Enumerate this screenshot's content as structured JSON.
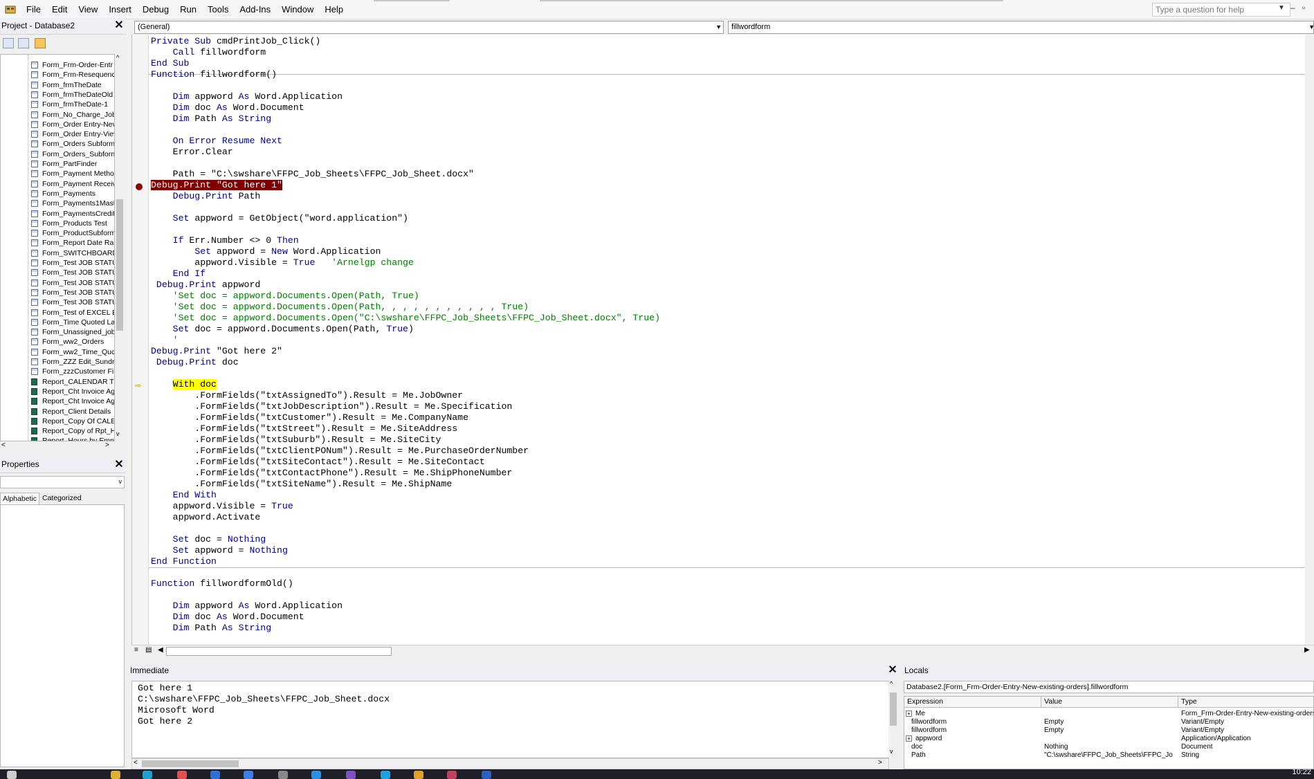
{
  "menu": [
    "File",
    "Edit",
    "View",
    "Insert",
    "Debug",
    "Run",
    "Tools",
    "Add-Ins",
    "Window",
    "Help"
  ],
  "help_placeholder": "Type a question for help",
  "project": {
    "title": "Project - Database2",
    "items": [
      {
        "label": "Form_Frm-Order-Entr",
        "type": "form"
      },
      {
        "label": "Form_Frm-Resequenc",
        "type": "form"
      },
      {
        "label": "Form_frmTheDate",
        "type": "form"
      },
      {
        "label": "Form_frmTheDateOld",
        "type": "form"
      },
      {
        "label": "Form_frmTheDate-1",
        "type": "form"
      },
      {
        "label": "Form_No_Charge_Job",
        "type": "form"
      },
      {
        "label": "Form_Order Entry-Nev",
        "type": "form"
      },
      {
        "label": "Form_Order Entry-Viev",
        "type": "form"
      },
      {
        "label": "Form_Orders Subform",
        "type": "form"
      },
      {
        "label": "Form_Orders_Subforn",
        "type": "form"
      },
      {
        "label": "Form_PartFinder",
        "type": "form"
      },
      {
        "label": "Form_Payment Methoc",
        "type": "form"
      },
      {
        "label": "Form_Payment Receiv",
        "type": "form"
      },
      {
        "label": "Form_Payments",
        "type": "form"
      },
      {
        "label": "Form_Payments1Mast",
        "type": "form"
      },
      {
        "label": "Form_PaymentsCredit",
        "type": "form"
      },
      {
        "label": "Form_Products Test",
        "type": "form"
      },
      {
        "label": "Form_ProductSubform",
        "type": "form"
      },
      {
        "label": "Form_Report Date Rar",
        "type": "form"
      },
      {
        "label": "Form_SWITCHBOARD",
        "type": "form"
      },
      {
        "label": "Form_Test JOB STATU",
        "type": "form"
      },
      {
        "label": "Form_Test JOB STATU",
        "type": "form"
      },
      {
        "label": "Form_Test JOB STATU",
        "type": "form"
      },
      {
        "label": "Form_Test JOB STATU",
        "type": "form"
      },
      {
        "label": "Form_Test JOB STATU",
        "type": "form"
      },
      {
        "label": "Form_Test of EXCEL E",
        "type": "form"
      },
      {
        "label": "Form_Time Quoted La",
        "type": "form"
      },
      {
        "label": "Form_Unassigned_job",
        "type": "form"
      },
      {
        "label": "Form_ww2_Orders",
        "type": "form"
      },
      {
        "label": "Form_ww2_Time_Quc",
        "type": "form"
      },
      {
        "label": "Form_ZZZ  Edit_Sundr",
        "type": "form"
      },
      {
        "label": "Form_zzzCustomer Fir",
        "type": "form"
      },
      {
        "label": "Report_CALENDAR TES",
        "type": "report"
      },
      {
        "label": "Report_Cht Invoice Ag",
        "type": "report"
      },
      {
        "label": "Report_Cht Invoice Ag",
        "type": "report"
      },
      {
        "label": "Report_Client Details",
        "type": "report"
      },
      {
        "label": "Report_Copy Of CALEN",
        "type": "report"
      },
      {
        "label": "Report_Copy of Rpt_H",
        "type": "report"
      },
      {
        "label": "Report_Hours by Empl",
        "type": "report"
      }
    ]
  },
  "properties": {
    "title": "Properties",
    "tabs": [
      "Alphabetic",
      "Categorized"
    ]
  },
  "code": {
    "object_combo": "(General)",
    "proc_combo": "fillwordform",
    "lines": [
      [
        [
          "k",
          "Private Sub "
        ],
        [
          "n",
          "cmdPrintJob_Click()"
        ]
      ],
      [
        [
          "n",
          "    "
        ],
        [
          "k",
          "Call"
        ],
        [
          "n",
          " fillwordform"
        ]
      ],
      [
        [
          "k",
          "End Sub"
        ]
      ],
      [
        [
          "k",
          "Function"
        ],
        [
          "n",
          " fillwordform()"
        ]
      ],
      [],
      [
        [
          "n",
          "    "
        ],
        [
          "k",
          "Dim"
        ],
        [
          "n",
          " appword "
        ],
        [
          "k",
          "As"
        ],
        [
          "n",
          " Word.Application"
        ]
      ],
      [
        [
          "n",
          "    "
        ],
        [
          "k",
          "Dim"
        ],
        [
          "n",
          " doc "
        ],
        [
          "k",
          "As"
        ],
        [
          "n",
          " Word.Document"
        ]
      ],
      [
        [
          "n",
          "    "
        ],
        [
          "k",
          "Dim"
        ],
        [
          "n",
          " Path "
        ],
        [
          "k",
          "As String"
        ]
      ],
      [],
      [
        [
          "n",
          "    "
        ],
        [
          "k",
          "On Error Resume Next"
        ]
      ],
      [
        [
          "n",
          "    Error.Clear"
        ]
      ],
      [],
      [
        [
          "n",
          "    Path = \"C:\\swshare\\FFPC_Job_Sheets\\FFPC_Job_Sheet.docx\""
        ]
      ],
      [
        [
          "b",
          "Debug.Print \"Got here 1\""
        ]
      ],
      [
        [
          "n",
          "    "
        ],
        [
          "k",
          "Debug.Print"
        ],
        [
          "n",
          " Path"
        ]
      ],
      [],
      [
        [
          "n",
          "    "
        ],
        [
          "k",
          "Set"
        ],
        [
          "n",
          " appword = GetObject(\"word.application\")"
        ]
      ],
      [],
      [
        [
          "n",
          "    "
        ],
        [
          "k",
          "If"
        ],
        [
          "n",
          " Err.Number <> 0 "
        ],
        [
          "k",
          "Then"
        ]
      ],
      [
        [
          "n",
          "        "
        ],
        [
          "k",
          "Set"
        ],
        [
          "n",
          " appword = "
        ],
        [
          "k",
          "New"
        ],
        [
          "n",
          " Word.Application"
        ]
      ],
      [
        [
          "n",
          "        appword.Visible = "
        ],
        [
          "k",
          "True"
        ],
        [
          "n",
          "   "
        ],
        [
          "c",
          "'Arnelgp change"
        ]
      ],
      [
        [
          "n",
          "    "
        ],
        [
          "k",
          "End If"
        ]
      ],
      [
        [
          "n",
          " "
        ],
        [
          "k",
          "Debug.Print"
        ],
        [
          "n",
          " appword"
        ]
      ],
      [
        [
          "n",
          "    "
        ],
        [
          "c",
          "'Set doc = appword.Documents.Open(Path, True)"
        ]
      ],
      [
        [
          "n",
          "    "
        ],
        [
          "c",
          "'Set doc = appword.Documents.Open(Path, , , , , , , , , , , True)"
        ]
      ],
      [
        [
          "n",
          "    "
        ],
        [
          "c",
          "'Set doc = appword.Documents.Open(\"C:\\swshare\\FFPC_Job_Sheets\\FFPC_Job_Sheet.docx\", True)"
        ]
      ],
      [
        [
          "n",
          "    "
        ],
        [
          "k",
          "Set"
        ],
        [
          "n",
          " doc = appword.Documents.Open(Path, "
        ],
        [
          "k",
          "True"
        ],
        [
          "n",
          ")"
        ]
      ],
      [
        [
          "n",
          "    "
        ],
        [
          "c",
          "'"
        ]
      ],
      [
        [
          "k",
          "Debug.Print"
        ],
        [
          "n",
          " \"Got here 2\""
        ]
      ],
      [
        [
          "n",
          " "
        ],
        [
          "k",
          "Debug.Print"
        ],
        [
          "n",
          " doc"
        ]
      ],
      [],
      [
        [
          "n",
          "    "
        ],
        [
          "h",
          "With doc"
        ]
      ],
      [
        [
          "n",
          "        .FormFields(\"txtAssignedTo\").Result = Me.JobOwner"
        ]
      ],
      [
        [
          "n",
          "        .FormFields(\"txtJobDescription\").Result = Me.Specification"
        ]
      ],
      [
        [
          "n",
          "        .FormFields(\"txtCustomer\").Result = Me.CompanyName"
        ]
      ],
      [
        [
          "n",
          "        .FormFields(\"txtStreet\").Result = Me.SiteAddress"
        ]
      ],
      [
        [
          "n",
          "        .FormFields(\"txtSuburb\").Result = Me.SiteCity"
        ]
      ],
      [
        [
          "n",
          "        .FormFields(\"txtClientPONum\").Result = Me.PurchaseOrderNumber"
        ]
      ],
      [
        [
          "n",
          "        .FormFields(\"txtSiteContact\").Result = Me.SiteContact"
        ]
      ],
      [
        [
          "n",
          "        .FormFields(\"txtContactPhone\").Result = Me.ShipPhoneNumber"
        ]
      ],
      [
        [
          "n",
          "        .FormFields(\"txtSiteName\").Result = Me.ShipName"
        ]
      ],
      [
        [
          "n",
          "    "
        ],
        [
          "k",
          "End With"
        ]
      ],
      [
        [
          "n",
          "    appword.Visible = "
        ],
        [
          "k",
          "True"
        ]
      ],
      [
        [
          "n",
          "    appword.Activate"
        ]
      ],
      [],
      [
        [
          "n",
          "    "
        ],
        [
          "k",
          "Set"
        ],
        [
          "n",
          " doc = "
        ],
        [
          "k",
          "Nothing"
        ]
      ],
      [
        [
          "n",
          "    "
        ],
        [
          "k",
          "Set"
        ],
        [
          "n",
          " appword = "
        ],
        [
          "k",
          "Nothing"
        ]
      ],
      [
        [
          "k",
          "End Function"
        ]
      ],
      [],
      [
        [
          "k",
          "Function"
        ],
        [
          "n",
          " fillwordformOld()"
        ]
      ],
      [],
      [
        [
          "n",
          "    "
        ],
        [
          "k",
          "Dim"
        ],
        [
          "n",
          " appword "
        ],
        [
          "k",
          "As"
        ],
        [
          "n",
          " Word.Application"
        ]
      ],
      [
        [
          "n",
          "    "
        ],
        [
          "k",
          "Dim"
        ],
        [
          "n",
          " doc "
        ],
        [
          "k",
          "As"
        ],
        [
          "n",
          " Word.Document"
        ]
      ],
      [
        [
          "n",
          "    "
        ],
        [
          "k",
          "Dim"
        ],
        [
          "n",
          " Path "
        ],
        [
          "k",
          "As String"
        ]
      ]
    ]
  },
  "immediate": {
    "title": "Immediate",
    "text": "Got here 1\nC:\\swshare\\FFPC_Job_Sheets\\FFPC_Job_Sheet.docx\nMicrosoft Word\nGot here 2"
  },
  "locals": {
    "title": "Locals",
    "context": "Database2.[Form_Frm-Order-Entry-New-existing-orders].fillwordform",
    "columns": [
      "Expression",
      "Value",
      "Type"
    ],
    "rows": [
      {
        "expr": "Me",
        "value": "",
        "type": "Form_Frm-Order-Entry-New-existing-orders",
        "expandable": true
      },
      {
        "expr": "fillwordform",
        "value": "Empty",
        "type": "Variant/Empty",
        "expandable": false
      },
      {
        "expr": "fillwordform",
        "value": "Empty",
        "type": "Variant/Empty",
        "expandable": false
      },
      {
        "expr": "appword",
        "value": "",
        "type": "Application/Application",
        "expandable": true
      },
      {
        "expr": "doc",
        "value": "Nothing",
        "type": "Document",
        "expandable": false
      },
      {
        "expr": "Path",
        "value": "\"C:\\swshare\\FFPC_Job_Sheets\\FFPC_Jo",
        "type": "String",
        "expandable": false
      }
    ]
  },
  "clock": "10:22"
}
